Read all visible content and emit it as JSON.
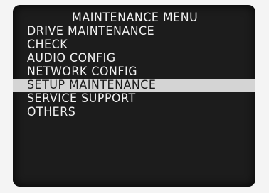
{
  "menu": {
    "title": "MAINTENANCE MENU",
    "items": [
      {
        "label": "DRIVE MAINTENANCE",
        "selected": false
      },
      {
        "label": "CHECK",
        "selected": false
      },
      {
        "label": "AUDIO CONFIG",
        "selected": false
      },
      {
        "label": "NETWORK CONFIG",
        "selected": false
      },
      {
        "label": "SETUP MAINTENANCE",
        "selected": true
      },
      {
        "label": "SERVICE SUPPORT",
        "selected": false
      },
      {
        "label": "OTHERS",
        "selected": false
      }
    ]
  },
  "colors": {
    "screen_background": "#1c1c1c",
    "text": "#f2f2f2",
    "highlight_background": "#d4d4d4",
    "highlight_text": "#1a1a1a"
  }
}
